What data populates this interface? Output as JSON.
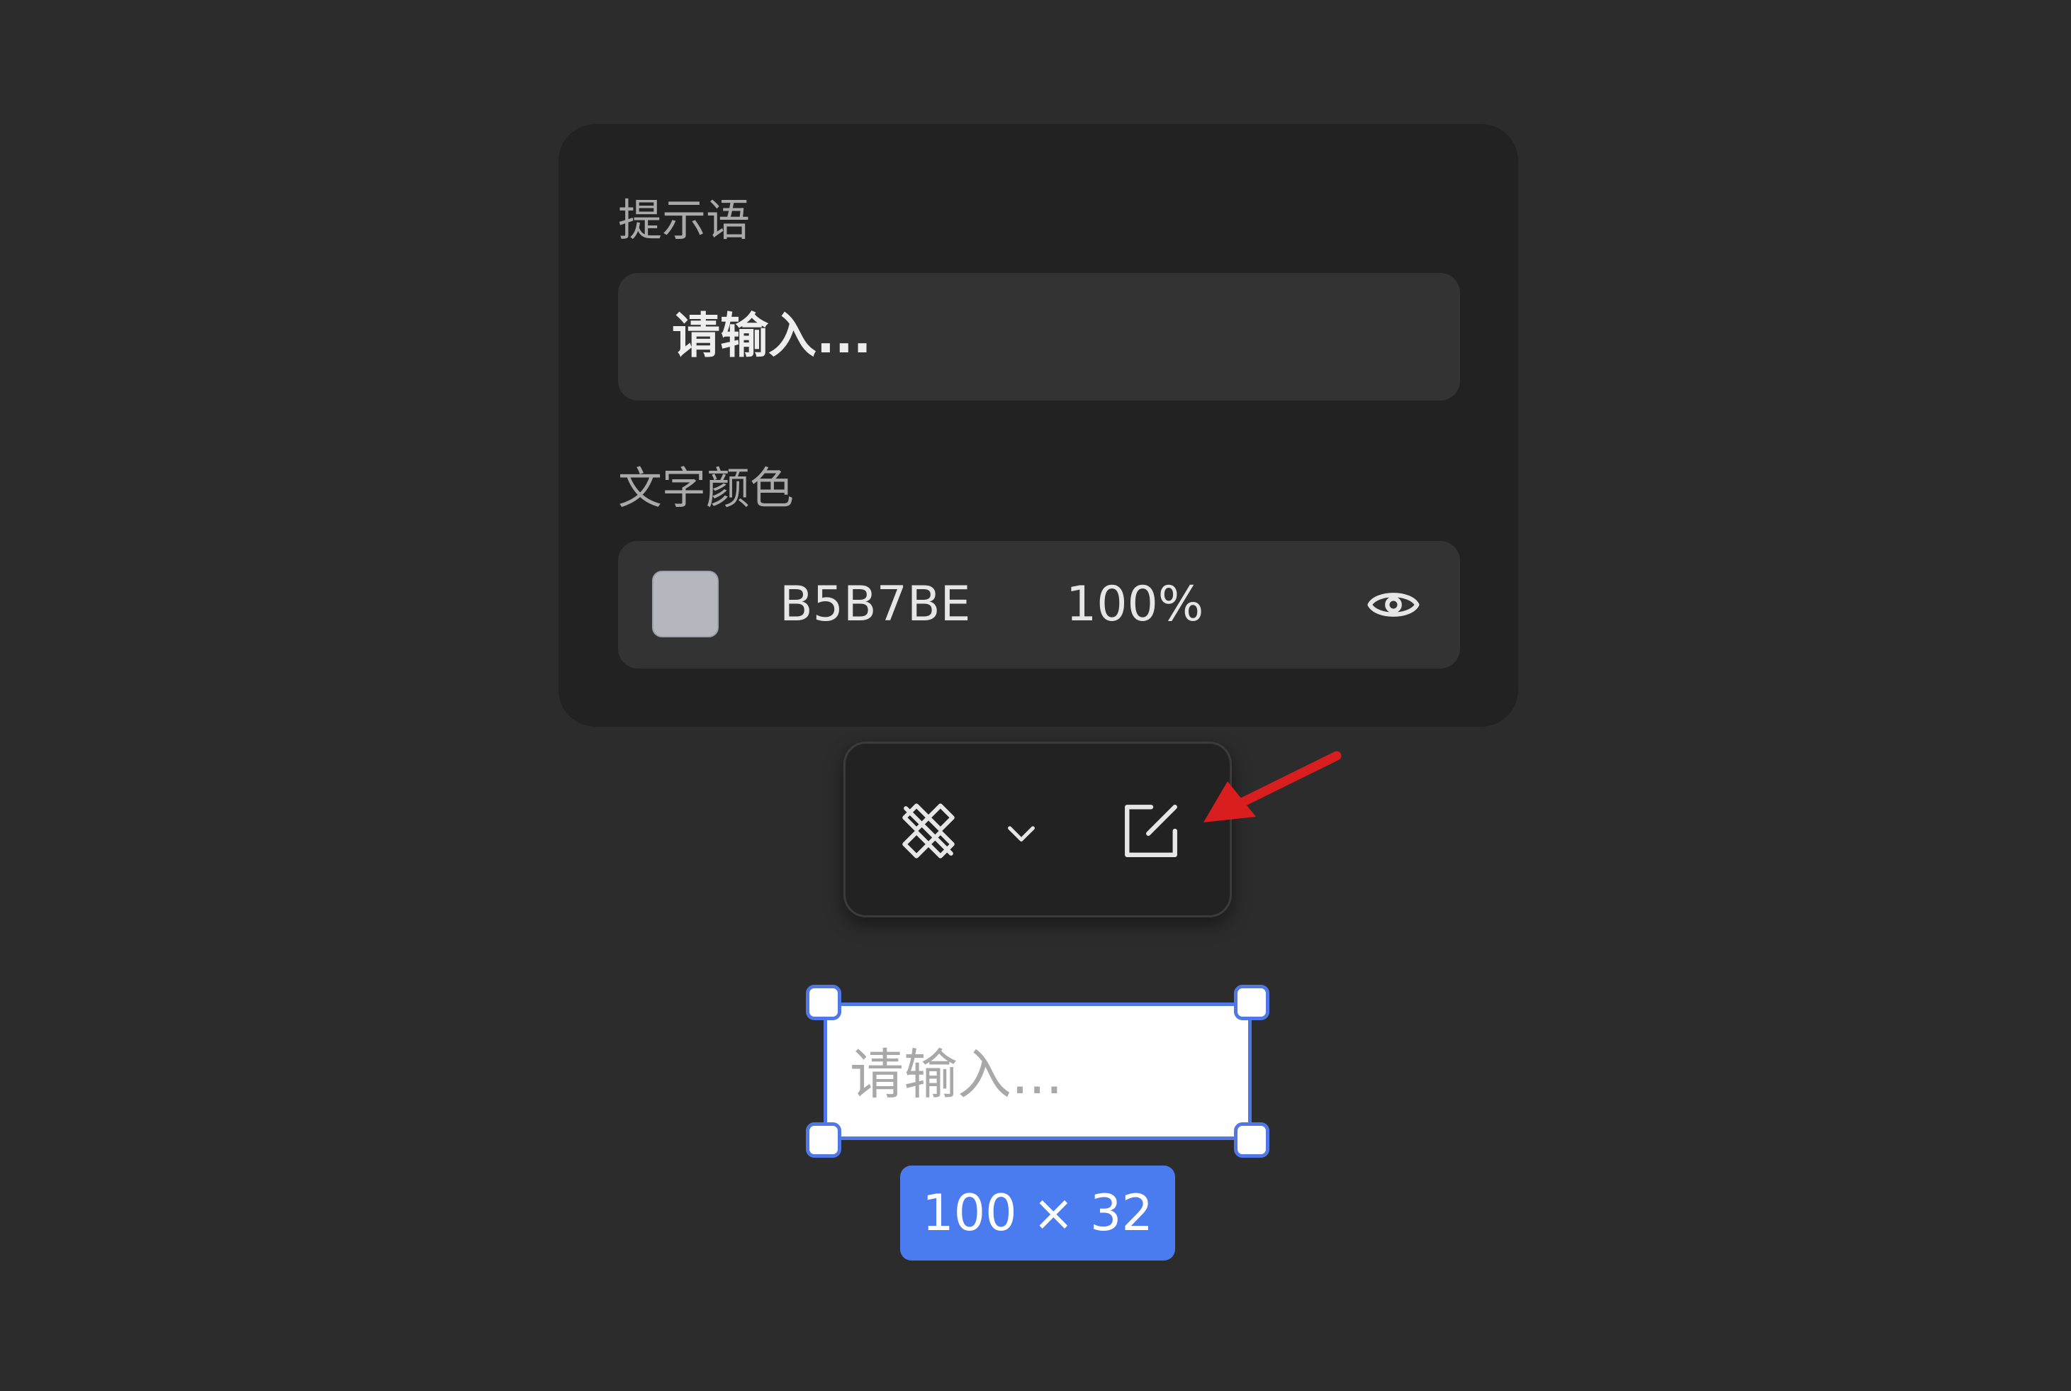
{
  "properties_panel": {
    "prompt_label": "提示语",
    "prompt_value": "请输入...",
    "text_color_label": "文字颜色",
    "color_hex": "B5B7BE",
    "color_opacity": "100%",
    "swatch_color": "#B5B7BE",
    "visibility_icon": "eye-icon"
  },
  "toolbar": {
    "component_icon": "component-icon",
    "dropdown_icon": "chevron-down-icon",
    "edit_icon": "edit-icon"
  },
  "annotation": {
    "arrow_color": "#D81E1E"
  },
  "canvas": {
    "placeholder_text": "请输入...",
    "size_label": "100 × 32",
    "selection_color": "#4F78E6"
  }
}
